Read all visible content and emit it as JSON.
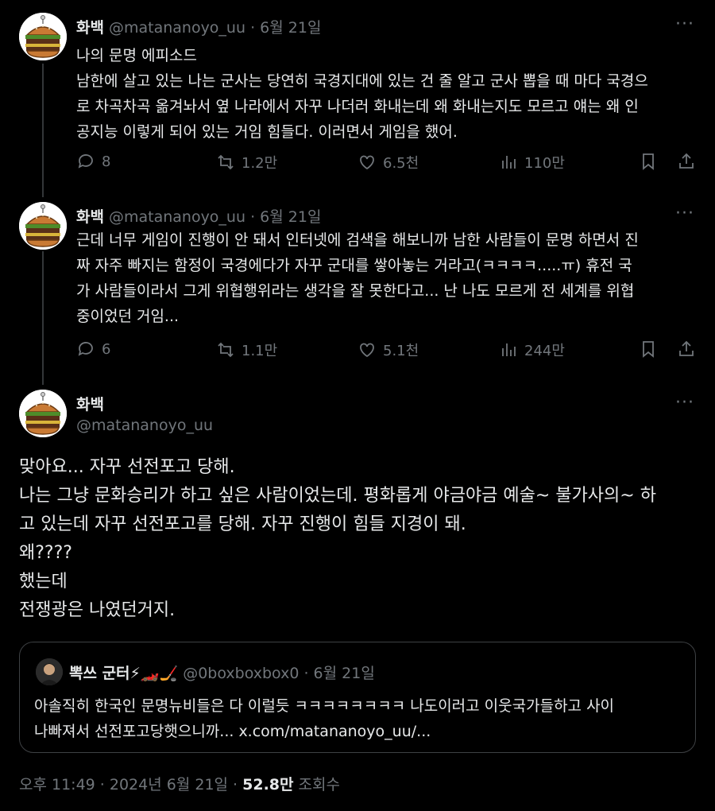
{
  "tweets": [
    {
      "name": "화백",
      "handle": "@matananoyo_uu",
      "sep": " · ",
      "date": "6월 21일",
      "more": "···",
      "lines": [
        "나의 문명 에피소드",
        "남한에 살고 있는 나는 군사는 당연히 국경지대에 있는 건 줄 알고 군사 뽑을 때 마다 국경으",
        "로 차곡차곡 옮겨놔서 옆 나라에서 자꾸 나더러 화내는데 왜 화내는지도 모르고 얘는 왜 인",
        "공지능 이렇게 되어 있는 거임 힘들다. 이러면서 게임을 했어."
      ],
      "replies": "8",
      "reposts": "1.2만",
      "likes": "6.5천",
      "views": "110만"
    },
    {
      "name": "화백",
      "handle": "@matananoyo_uu",
      "sep": " · ",
      "date": "6월 21일",
      "more": "···",
      "lines": [
        "근데 너무 게임이 진행이 안 돼서 인터넷에 검색을 해보니까 남한 사람들이 문명 하면서 진",
        "짜 자주 빠지는 함정이 국경에다가 자꾸 군대를 쌓아놓는  거라고(ㅋㅋㅋㅋ.....ㅠ) 휴전 국",
        "가 사람들이라서 그게 위협행위라는 생각을 잘 못한다고... 난 나도 모르게 전 세계를 위협",
        "중이었던 거임..."
      ],
      "replies": "6",
      "reposts": "1.1만",
      "likes": "5.1천",
      "views": "244만"
    }
  ],
  "main": {
    "name": "화백",
    "handle": "@matananoyo_uu",
    "more": "···",
    "lines": [
      "맞아요... 자꾸 선전포고 당해.",
      "나는 그냥 문화승리가 하고 싶은 사람이었는데. 평화롭게 야금야금 예술~ 불가사의~ 하",
      "고 있는데 자꾸 선전포고를 당해. 자꾸 진행이 힘들 지경이 돼.",
      "왜????",
      "했는데",
      "전쟁광은 나였던거지."
    ]
  },
  "quote": {
    "name": "뽁쓰 군터⚡🏎️🏒",
    "handle": "@0boxboxbox0",
    "sep": " · ",
    "date": "6월 21일",
    "lines": [
      "아솔직히 한국인 문명뉴비들은 다 이럴듯 ㅋㅋㅋㅋㅋㅋㅋㅋ 나도이러고 이웃국가들하고 사이",
      "나빠져서 선전포고당햇으니까... x.com/matananoyo_uu/..."
    ]
  },
  "footer": {
    "time": "오후 11:49 · 2024년 6월 21일 · ",
    "views": "52.8만",
    "views_label": " 조회수"
  },
  "colors": {
    "background": "#000000",
    "text": "#e7e9ea",
    "muted": "#71767b",
    "border": "#3e4144"
  }
}
